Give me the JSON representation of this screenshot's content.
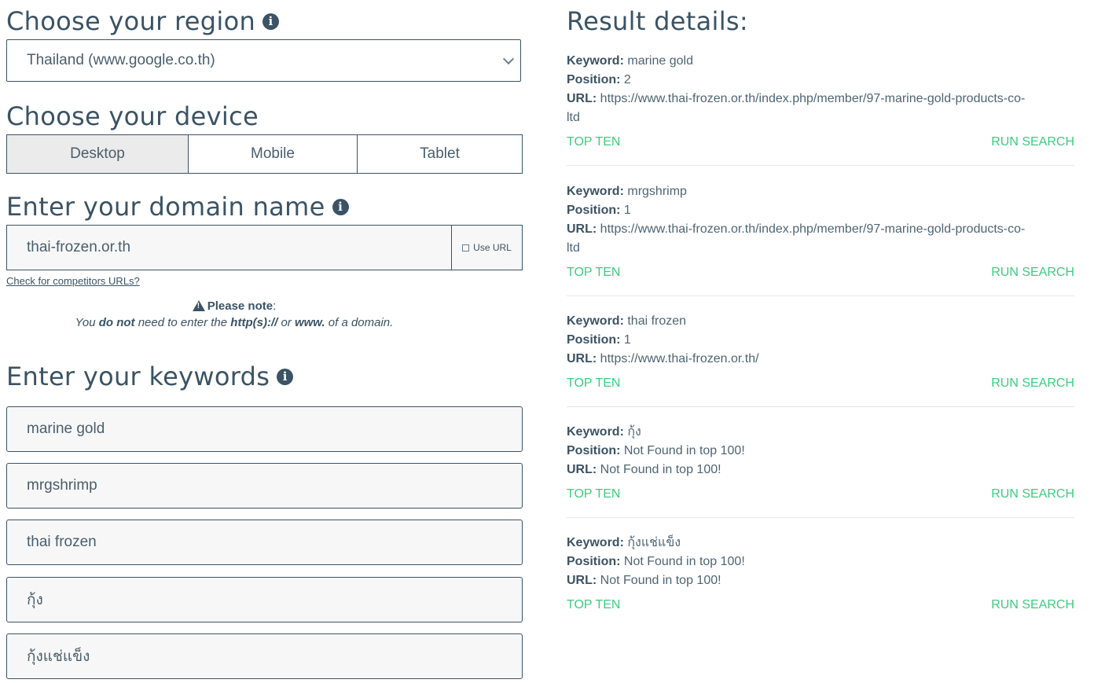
{
  "region": {
    "heading": "Choose your region",
    "selected": "Thailand (www.google.co.th)"
  },
  "device": {
    "heading": "Choose your device",
    "options": [
      "Desktop",
      "Mobile",
      "Tablet"
    ],
    "selected": "Desktop"
  },
  "domain": {
    "heading": "Enter your domain name",
    "value": "thai-frozen.or.th",
    "use_url_label": "Use URL",
    "competitors_link": "Check for competitors URLs?"
  },
  "note": {
    "title": "Please note",
    "text_parts": [
      "You ",
      "do not",
      " need to enter the ",
      "http(s)://",
      " or ",
      "www.",
      " of a domain."
    ]
  },
  "keywords": {
    "heading": "Enter your keywords",
    "values": [
      "marine gold",
      "mrgshrimp",
      "thai frozen",
      "กุ้ง",
      "กุ้งแช่แข็ง"
    ]
  },
  "results": {
    "heading": "Result details:",
    "labels": {
      "keyword": "Keyword:",
      "position": "Position:",
      "url": "URL:"
    },
    "top_ten_label": "TOP TEN",
    "run_search_label": "RUN SEARCH",
    "items": [
      {
        "keyword": "marine gold",
        "position": "2",
        "url_line1": "https://www.thai-frozen.or.th/index.php/member/97-marine-gold-products-co-",
        "url_line2": "ltd"
      },
      {
        "keyword": "mrgshrimp",
        "position": "1",
        "url_line1": "https://www.thai-frozen.or.th/index.php/member/97-marine-gold-products-co-",
        "url_line2": "ltd"
      },
      {
        "keyword": "thai frozen",
        "position": "1",
        "url_line1": "https://www.thai-frozen.or.th/",
        "url_line2": ""
      },
      {
        "keyword": "กุ้ง",
        "position": "Not Found in top 100!",
        "url_line1": "Not Found in top 100!",
        "url_line2": ""
      },
      {
        "keyword": "กุ้งแช่แข็ง",
        "position": "Not Found in top 100!",
        "url_line1": "Not Found in top 100!",
        "url_line2": ""
      }
    ]
  },
  "colors": {
    "text": "#3b5364",
    "accent": "#3ecb80",
    "input_bg": "#f7f7f7"
  }
}
